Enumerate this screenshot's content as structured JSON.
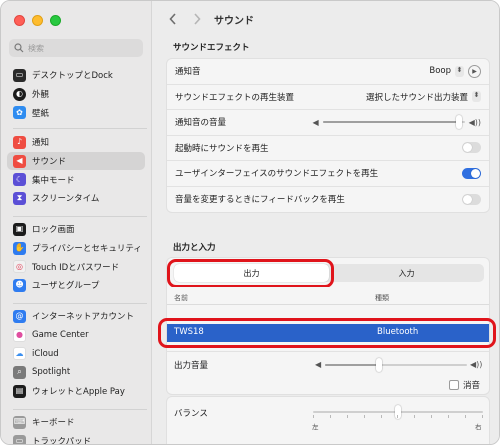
{
  "window": {
    "title": "サウンド"
  },
  "search": {
    "placeholder": "検索"
  },
  "sidebar": {
    "group1": [
      {
        "label": "デスクトップとDock",
        "icon": "desktop-icon",
        "color": "#2a2a2a"
      },
      {
        "label": "外観",
        "icon": "appearance-icon",
        "color": "#1c1c1c"
      },
      {
        "label": "壁紙",
        "icon": "wallpaper-icon",
        "color": "#2f8cf0"
      }
    ],
    "group2": [
      {
        "label": "通知",
        "icon": "bell-icon",
        "color": "#ef4d42"
      },
      {
        "label": "サウンド",
        "icon": "speaker-icon",
        "color": "#ef4d42",
        "selected": true
      },
      {
        "label": "集中モード",
        "icon": "moon-icon",
        "color": "#5b4fd6"
      },
      {
        "label": "スクリーンタイム",
        "icon": "hourglass-icon",
        "color": "#5b4fd6"
      }
    ],
    "group3": [
      {
        "label": "ロック画面",
        "icon": "lock-icon",
        "color": "#1c1c1c"
      },
      {
        "label": "プライバシーとセキュリティ",
        "icon": "hand-icon",
        "color": "#2f7cf0"
      },
      {
        "label": "Touch IDとパスワード",
        "icon": "fingerprint-icon",
        "color": "#f1f1f1"
      },
      {
        "label": "ユーザとグループ",
        "icon": "users-icon",
        "color": "#2f7cf0"
      }
    ],
    "group4": [
      {
        "label": "インターネットアカウント",
        "icon": "at-icon",
        "color": "#2f7cf0"
      },
      {
        "label": "Game Center",
        "icon": "game-center-icon",
        "color": "#ffffff"
      },
      {
        "label": "iCloud",
        "icon": "cloud-icon",
        "color": "#ffffff"
      },
      {
        "label": "Spotlight",
        "icon": "spotlight-icon",
        "color": "#7a7a7a"
      },
      {
        "label": "ウォレットとApple Pay",
        "icon": "wallet-icon",
        "color": "#1c1c1c"
      }
    ],
    "group5": [
      {
        "label": "キーボード",
        "icon": "keyboard-icon",
        "color": "#9a9a9a"
      },
      {
        "label": "トラックパッド",
        "icon": "trackpad-icon",
        "color": "#9a9a9a"
      }
    ]
  },
  "sound_effects": {
    "title": "サウンドエフェクト",
    "alert_sound": {
      "label": "通知音",
      "value": "Boop"
    },
    "play_device": {
      "label": "サウンドエフェクトの再生装置",
      "value": "選択したサウンド出力装置"
    },
    "alert_volume": {
      "label": "通知音の音量",
      "level": 0.96
    },
    "startup_sound": {
      "label": "起動時にサウンドを再生",
      "on": false
    },
    "ui_sound": {
      "label": "ユーザインターフェイスのサウンドエフェクトを再生",
      "on": true
    },
    "feedback": {
      "label": "音量を変更するときにフィードバックを再生",
      "on": false
    }
  },
  "io": {
    "title": "出力と入力",
    "tab_output": "出力",
    "tab_input": "入力",
    "col_name": "名前",
    "col_type": "種類",
    "device": {
      "name": "TWS18",
      "type": "Bluetooth"
    },
    "output_volume": {
      "label": "出力音量",
      "level": 0.38
    },
    "mute": {
      "label": "消音",
      "checked": false
    },
    "balance": {
      "label": "バランス",
      "left": "左",
      "right": "右",
      "level": 0.5
    }
  },
  "colors": {
    "accent": "#2f6fe0",
    "highlight": "#e0141b",
    "selected_row": "#2a62c9"
  }
}
